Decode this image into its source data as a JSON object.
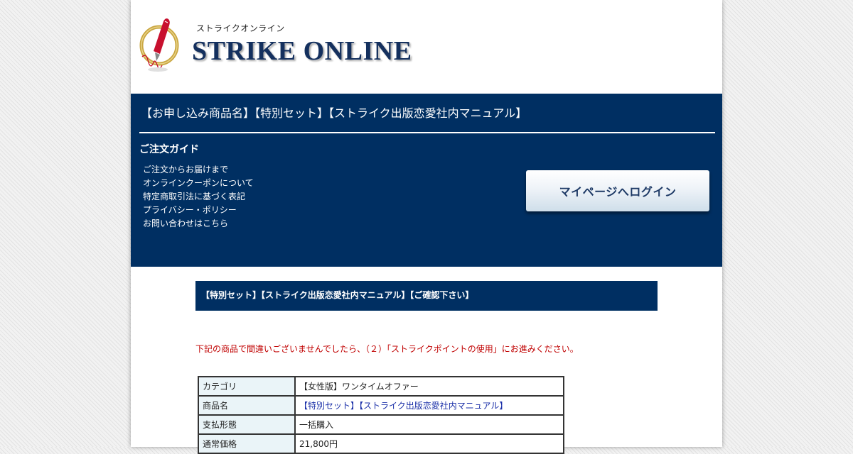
{
  "logo": {
    "kana": "ストライクオンライン",
    "name": "STRIKE ONLINE",
    "icon": "fountain-pen-icon"
  },
  "product_heading": "【お申し込み商品名】【特別セット】【ストライク出版恋愛社内マニュアル】",
  "guide": {
    "title": "ご注文ガイド",
    "links": [
      "ご注文からお届けまで",
      "オンラインクーポンについて",
      "特定商取引法に基づく表記",
      "プライバシー・ポリシー",
      "お問い合わせはこちら"
    ]
  },
  "mypage_button": "マイページへログイン",
  "confirm_heading": "【特別セット】【ストライク出版恋愛社内マニュアル】【ご確認下さい】",
  "notice": "下記の商品で間違いございませんでしたら、（２）「ストライクポイントの使用」にお進みください。",
  "table": [
    {
      "label": "カテゴリ",
      "value": "【女性版】ワンタイムオファー"
    },
    {
      "label": "商品名",
      "value": "【特別セット】【ストライク出版恋愛社内マニュアル】"
    },
    {
      "label": "支払形態",
      "value": "一括購入"
    },
    {
      "label": "通常価格",
      "value": "21,800円"
    }
  ],
  "colors": {
    "navy": "#002f62",
    "notice_red": "#c00000",
    "link_blue": "#1a2fa8",
    "label_bg": "#eaf4f8"
  }
}
